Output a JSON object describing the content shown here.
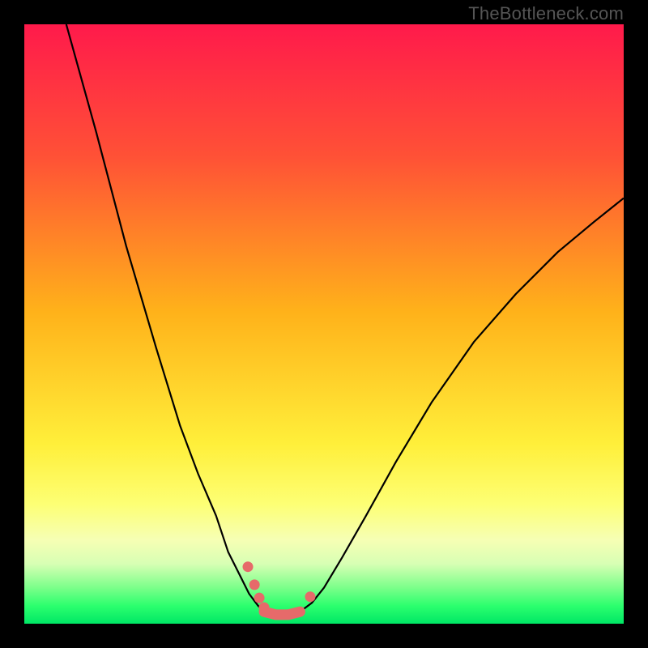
{
  "watermark": "TheBottleneck.com",
  "chart_data": {
    "type": "line",
    "title": "",
    "xlabel": "",
    "ylabel": "",
    "xlim": [
      0,
      100
    ],
    "ylim": [
      0,
      100
    ],
    "background_gradient": [
      {
        "pos": 0.0,
        "color": "#ff1a4b"
      },
      {
        "pos": 0.22,
        "color": "#ff5136"
      },
      {
        "pos": 0.48,
        "color": "#ffb21a"
      },
      {
        "pos": 0.7,
        "color": "#ffef3a"
      },
      {
        "pos": 0.8,
        "color": "#fdff74"
      },
      {
        "pos": 0.86,
        "color": "#f6ffb4"
      },
      {
        "pos": 0.9,
        "color": "#d8ffb4"
      },
      {
        "pos": 0.94,
        "color": "#7bff8a"
      },
      {
        "pos": 0.97,
        "color": "#2cff6e"
      },
      {
        "pos": 1.0,
        "color": "#00e765"
      }
    ],
    "series": [
      {
        "name": "bottleneck-left",
        "stroke": "#000000",
        "stroke_width": 2.2,
        "x": [
          7.0,
          12.0,
          17.0,
          22.0,
          26.0,
          29.0,
          32.0,
          34.0,
          36.0,
          37.5,
          39.0,
          40.0
        ],
        "y": [
          100.0,
          82.0,
          63.0,
          46.0,
          33.0,
          25.0,
          18.0,
          12.0,
          8.0,
          5.0,
          3.0,
          2.0
        ]
      },
      {
        "name": "bottleneck-right",
        "stroke": "#000000",
        "stroke_width": 2.2,
        "x": [
          46.0,
          48.0,
          50.0,
          53.0,
          57.0,
          62.0,
          68.0,
          75.0,
          82.0,
          89.0,
          95.0,
          100.0
        ],
        "y": [
          2.0,
          3.5,
          6.0,
          11.0,
          18.0,
          27.0,
          37.0,
          47.0,
          55.0,
          62.0,
          67.0,
          71.0
        ]
      },
      {
        "name": "valley-floor",
        "stroke": "#e66a6a",
        "stroke_width": 13,
        "linecap": "round",
        "x": [
          40.0,
          42.0,
          44.0,
          46.0
        ],
        "y": [
          2.0,
          1.5,
          1.5,
          2.0
        ]
      }
    ],
    "markers": [
      {
        "name": "left-dot-1",
        "x": 37.3,
        "y": 9.5,
        "r": 6.5,
        "color": "#e66a6a"
      },
      {
        "name": "left-dot-2",
        "x": 38.4,
        "y": 6.5,
        "r": 6.5,
        "color": "#e66a6a"
      },
      {
        "name": "left-dot-3",
        "x": 39.2,
        "y": 4.3,
        "r": 6.5,
        "color": "#e66a6a"
      },
      {
        "name": "left-dot-4",
        "x": 40.0,
        "y": 2.7,
        "r": 6.5,
        "color": "#e66a6a"
      },
      {
        "name": "right-dot-1",
        "x": 47.7,
        "y": 4.5,
        "r": 6.5,
        "color": "#e66a6a"
      }
    ]
  }
}
